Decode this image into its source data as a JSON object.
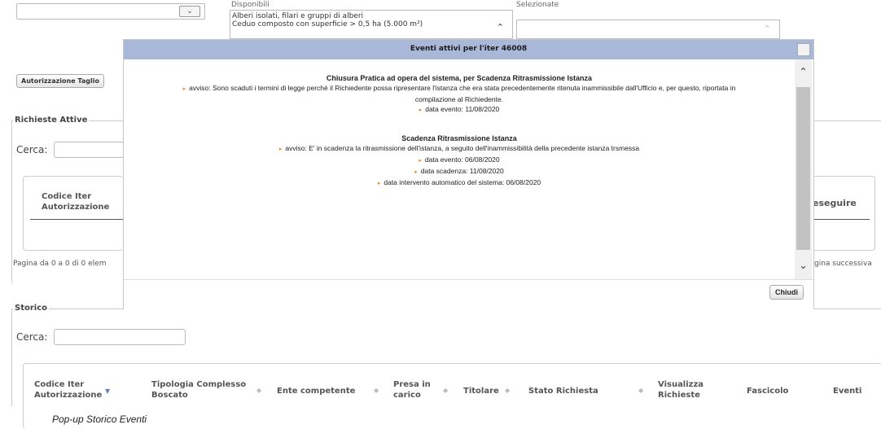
{
  "top": {
    "select_value": "",
    "disponibili_label": "Disponibili",
    "selezionate_label": "Selezionate",
    "disponibili_items": [
      "Alberi isolati, filari e gruppi di alberi",
      "Ceduo composto con superficie > 0,5 ha (5.000 m²)"
    ],
    "autorizzazione_button": "Autorizzazione Taglio"
  },
  "richieste": {
    "legend": "Richieste Attive",
    "cerca_label": "Cerca:",
    "search_value": "",
    "col_codice": [
      "Codice Iter",
      "Autorizzazione"
    ],
    "col_right": "eseguire",
    "pager": "Pagina da 0 a 0 di 0 elem",
    "next": "gina successiva"
  },
  "storico": {
    "legend": "Storico",
    "cerca_label": "Cerca:",
    "search_value": "",
    "columns": [
      [
        "Codice Iter",
        "Autorizzazione"
      ],
      [
        "Tipologia Complesso",
        "Boscato"
      ],
      [
        "Ente competente"
      ],
      [
        "Presa in",
        "carico"
      ],
      [
        "Titolare"
      ],
      [
        "Stato Richiesta"
      ],
      [
        "Visualizza",
        "Richieste"
      ],
      [
        "Fascicolo"
      ],
      [
        "Eventi"
      ]
    ]
  },
  "modal": {
    "title": "Eventi attivi per l'iter 46008",
    "close_button": "Chiudi",
    "events": [
      {
        "title": "Chiusura Pratica ad opera del sistema, per Scadenza Ritrasmissione Istanza",
        "avviso": "avviso: Sono scaduti i termini di legge perchè il Richiedente possa ripresentare l'istanza che era stata precedentemente ritenuta inammissibile dall'Ufficio e, per questo, riportata in",
        "avviso_cont": "compilazione al Richiedente.",
        "details": [
          "data evento: 11/08/2020"
        ]
      },
      {
        "title": "Scadenza Ritrasmissione Istanza",
        "avviso": "avviso: E' in scadenza la ritrasmissione dell'istanza, a seguito dell'inammissibilità della precedente istanza trsmessa",
        "avviso_cont": "",
        "details": [
          "data evento: 06/08/2020",
          "data scadenza: 11/08/2020",
          "data intervento automatico del sistema: 06/08/2020"
        ]
      }
    ]
  },
  "caption": "Pop-up Storico Eventi",
  "colors": {
    "modal_header": "#a9b8d8",
    "bullet": "#e08a2b"
  }
}
